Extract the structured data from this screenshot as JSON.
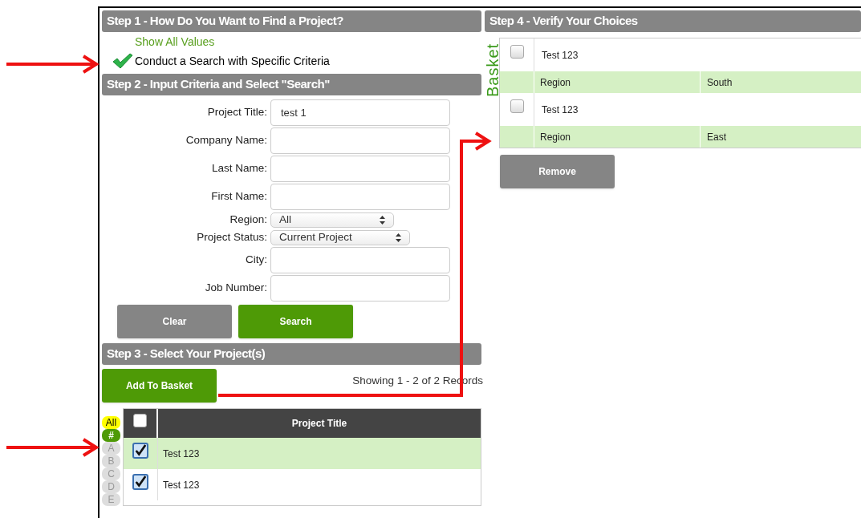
{
  "step1": {
    "title": "Step 1 - How Do You Want to Find a Project?",
    "options": [
      {
        "label": "Show All Values",
        "selected": false
      },
      {
        "label": "Conduct a Search with Specific Criteria",
        "selected": true
      }
    ]
  },
  "step2": {
    "title": "Step 2 - Input Criteria and Select \"Search\"",
    "fields": [
      {
        "kind": "text",
        "label": "Project Title:",
        "value": "test 1"
      },
      {
        "kind": "text",
        "label": "Company Name:"
      },
      {
        "kind": "text",
        "label": "Last Name:"
      },
      {
        "kind": "text",
        "label": "First Name:"
      },
      {
        "kind": "select",
        "label": "Region:",
        "value": "All"
      },
      {
        "kind": "select",
        "label": "Project Status:",
        "value": "Current Project"
      },
      {
        "kind": "text",
        "label": "City:"
      },
      {
        "kind": "text",
        "label": "Job Number:"
      }
    ],
    "buttons": [
      {
        "label": "Clear",
        "kind": "secondary"
      },
      {
        "label": "Search",
        "kind": "primary"
      }
    ]
  },
  "step3": {
    "title": "Step 3 - Select Your Project(s)",
    "add_button": "Add To Basket",
    "record_count": "Showing 1 - 2 of 2 Records",
    "letters": [
      {
        "label": "All",
        "color": "#ffff00",
        "selected": false
      },
      {
        "label": "#",
        "color": "#4e9a06",
        "selected": true
      },
      {
        "label": "A",
        "color": "#dddddd",
        "selected": false
      },
      {
        "label": "B",
        "color": "#dddddd",
        "selected": false
      },
      {
        "label": "C",
        "color": "#dddddd",
        "selected": false
      },
      {
        "label": "D",
        "color": "#dddddd",
        "selected": false
      },
      {
        "label": "E",
        "color": "#dddddd",
        "selected": false
      }
    ],
    "table": {
      "select_all_checked": false,
      "columns": [
        "Project Title"
      ],
      "rows": [
        {
          "title": "Test 123",
          "checked": true,
          "selected": true
        },
        {
          "title": "Test 123",
          "checked": true,
          "selected": false
        }
      ]
    }
  },
  "step4": {
    "title": "Step 4 - Verify Your Choices",
    "basket_label": "Basket",
    "items": [
      {
        "title": "Test 123",
        "checked": false,
        "details": [
          {
            "label": "Region",
            "value": "South"
          }
        ]
      },
      {
        "title": "Test 123",
        "checked": false,
        "details": [
          {
            "label": "Region",
            "value": "East"
          }
        ]
      }
    ],
    "remove_button": "Remove"
  }
}
